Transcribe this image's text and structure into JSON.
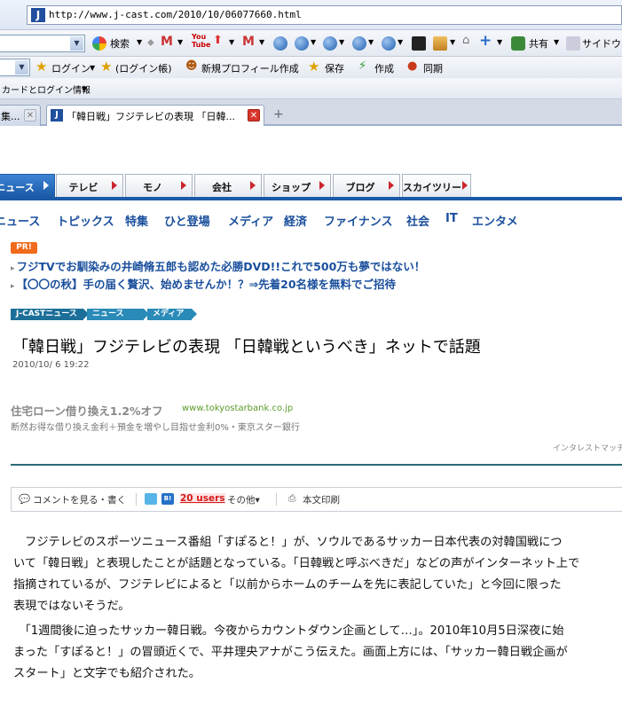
{
  "browser": {
    "url": "http://www.j-cast.com/2010/10/06077660.html",
    "favicon_letter": "J",
    "toolbar": {
      "search_label": "検索",
      "share_label": "共有",
      "sidewiki_label": "サイドウィ"
    },
    "toolbar2": {
      "login_label": "ログイン",
      "login_book_label": "(ログイン帳)",
      "new_profile_label": "新規プロフィール作成",
      "save_label": "保存",
      "create_label": "作成",
      "sync_label": "同期"
    },
    "toolbar3": {
      "card_login_label": "カードとログイン情報"
    },
    "tabs": [
      {
        "label": "集..."
      },
      {
        "label": "「韓日戦」フジテレビの表現 「日韓..."
      }
    ],
    "new_tab_symbol": "+"
  },
  "site": {
    "nav_tabs": [
      {
        "label": "ニュース"
      },
      {
        "label": "テレビ"
      },
      {
        "label": "モノ"
      },
      {
        "label": "会社"
      },
      {
        "label": "ショップ"
      },
      {
        "label": "ブログ"
      },
      {
        "label": "スカイツリー"
      }
    ],
    "categories": [
      "ニュース",
      "トピックス",
      "特集",
      "ひと登場",
      "メディア",
      "経済",
      "ファイナンス",
      "社会",
      "IT",
      "エンタメ"
    ],
    "pr_badge": "PR!",
    "pr_links": [
      "フジTVでお馴染みの井崎脩五郎も認めた必勝DVD!!これで500万も夢ではない！",
      "【〇〇の秋】手の届く贅沢、始めませんか！？⇒先着20名様を無料でご招待"
    ],
    "breadcrumbs": [
      "J-CASTニュース",
      "ニュース",
      "メディア"
    ]
  },
  "article": {
    "headline": "「韓日戦」フジテレビの表現 「日韓戦というべき」ネットで話題",
    "date": "2010/10/ 6 19:22",
    "ad": {
      "title": "住宅ローン借り換え1.2%オフ",
      "url": "www.tokyostarbank.co.jp",
      "desc": "断然お得な借り換え金利＋預金を増やし目指せ金利0%・東京スター銀行",
      "by": "インタレストマッチ"
    },
    "social": {
      "comment": "コメントを見る・書く",
      "users": "20 users",
      "other": "その他▾",
      "print": "本文印刷"
    },
    "body_lines": [
      "　フジテレビのスポーツニュース番組「すぽると！」が、ソウルであるサッカー日本代表の対韓国戦につ",
      "いて「韓日戦」と表現したことが話題となっている。「日韓戦と呼ぶべきだ」などの声がインターネット上で",
      "指摘されているが、フジテレビによると「以前からホームのチームを先に表記していた」と今回に限った",
      "表現ではないそうだ。",
      "　「1週間後に迫ったサッカー韓日戦。今夜からカウントダウン企画として…」。2010年10月5日深夜に始",
      "まった「すぽると！」の冒頭近くで、平井理央アナがこう伝えた。画面上方には、「サッカー韓日戦企画が",
      "スタート」と文字でも紹介された。"
    ]
  }
}
